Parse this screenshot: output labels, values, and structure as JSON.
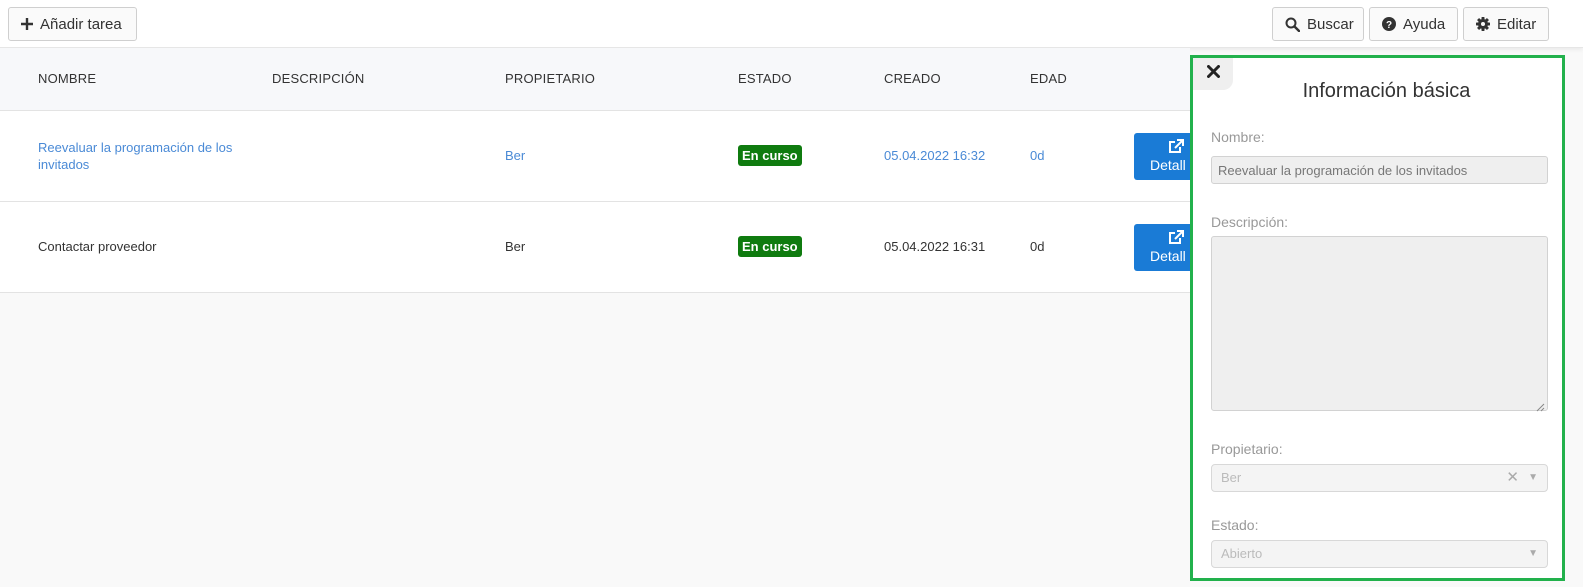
{
  "toolbar": {
    "add_label": "Añadir tarea",
    "search_label": "Buscar",
    "help_label": "Ayuda",
    "edit_label": "Editar"
  },
  "table": {
    "columns": {
      "name": "NOMBRE",
      "description": "DESCRIPCIÓN",
      "owner": "PROPIETARIO",
      "status": "ESTADO",
      "created": "CREADO",
      "age": "EDAD"
    },
    "rows": [
      {
        "name": "Reevaluar la programación de los invitados",
        "description": "",
        "owner": "Ber",
        "status": "En curso",
        "created": "05.04.2022 16:32",
        "age": "0d",
        "detail_label": "Detall"
      },
      {
        "name": "Contactar proveedor",
        "description": "",
        "owner": "Ber",
        "status": "En curso",
        "created": "05.04.2022 16:31",
        "age": "0d",
        "detail_label": "Detall"
      }
    ]
  },
  "panel": {
    "title": "Información básica",
    "name_label": "Nombre:",
    "name_value": "Reevaluar la programación de los invitados",
    "description_label": "Descripción:",
    "owner_label": "Propietario:",
    "owner_value": "Ber",
    "status_label": "Estado:",
    "status_value": "Abierto"
  },
  "colors": {
    "link": "#4a8ad6",
    "status_badge": "#0f7b0f",
    "detail_button": "#1a7bd6",
    "panel_border": "#22b14c"
  },
  "icons": {
    "add": "plus-icon",
    "search": "search-icon",
    "help": "question-circle-icon",
    "edit": "gear-icon",
    "detail": "external-link-icon",
    "close": "close-icon"
  }
}
